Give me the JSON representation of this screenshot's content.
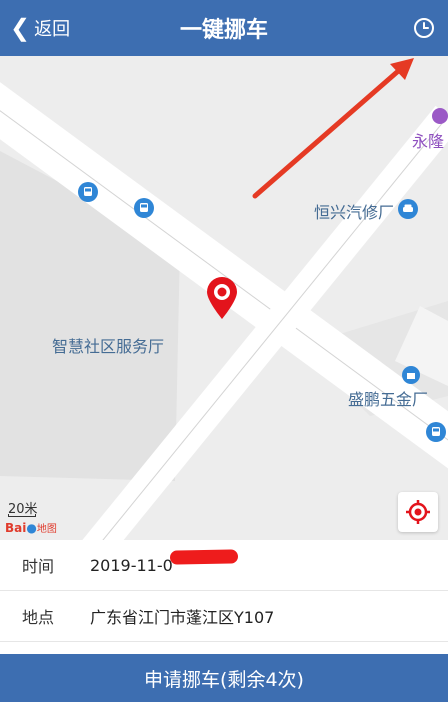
{
  "header": {
    "back_label": "返回",
    "title": "一键挪车"
  },
  "map": {
    "labels": {
      "yonglong": "永隆",
      "hengxing": "恒兴汽修厂",
      "zhihui": "智慧社区服务厅",
      "shengpeng": "盛鹏五金厂"
    },
    "scale_text": "20米",
    "logo_text": "Bai",
    "logo_map_text": "地图"
  },
  "info": {
    "time_label": "时间",
    "time_value": "2019-11-0",
    "location_label": "地点",
    "location_value": "广东省江门市蓬江区Y107"
  },
  "submit": {
    "label": "申请挪车(剩余4次)"
  },
  "colors": {
    "primary": "#3d6eb1",
    "marker": "#e3141c",
    "poi": "#2f86d6",
    "arrow": "#e53a24"
  },
  "icons": {
    "back": "chevron-left-icon",
    "history": "clock-icon",
    "locate": "locate-target-icon",
    "marker": "map-pin-icon",
    "bus": "bus-stop-icon",
    "car": "car-service-icon"
  }
}
